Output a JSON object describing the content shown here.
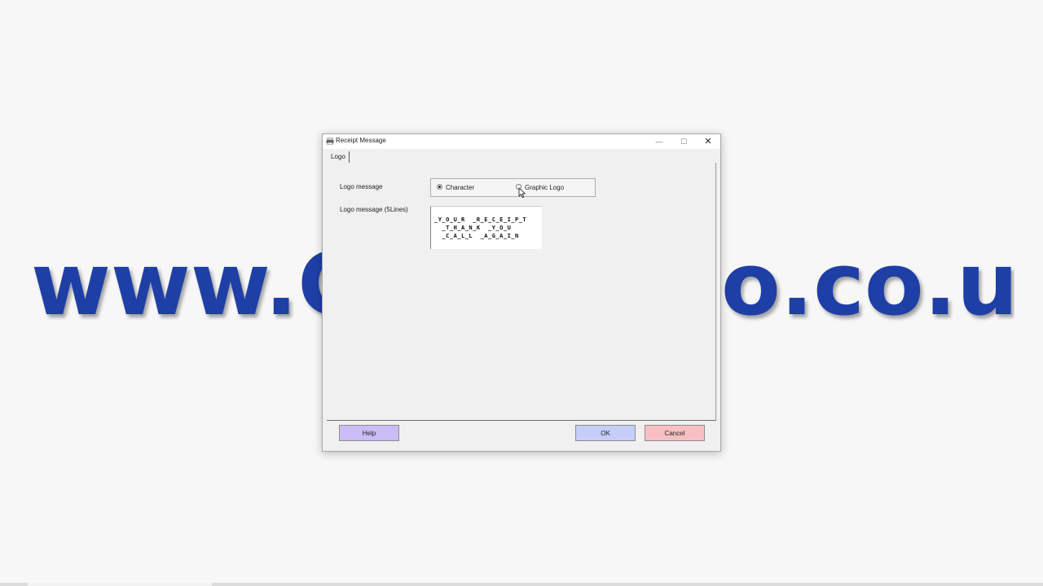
{
  "watermark": {
    "left_text": "www.C",
    "right_text": "o.co.uk"
  },
  "window": {
    "title": "Receipt Message",
    "controls": {
      "minimize": "—",
      "maximize": "☐",
      "close": "✕"
    }
  },
  "tabs": [
    {
      "label": "Logo",
      "selected": true
    }
  ],
  "form": {
    "logo_message_label": "Logo message",
    "logo_message_5lines_label": "Logo message (5Lines)",
    "radio_options": [
      {
        "label": "Character",
        "checked": true
      },
      {
        "label": "Graphic Logo",
        "checked": false
      }
    ],
    "logo_lines": [
      "_Y_O_U_R  _R_E_C_E_I_P_T",
      "  _T_H_A_N_K  _Y_O_U",
      "  _C_A_L_L  _A_G_A_I_N"
    ]
  },
  "buttons": {
    "help": "Help",
    "ok": "OK",
    "cancel": "Cancel"
  },
  "colors": {
    "watermark": "#1e3fa6",
    "help_button": "#cbbcf6",
    "ok_button": "#c4cef7",
    "cancel_button": "#f8c0c2"
  },
  "icons": {
    "app": "printer-icon",
    "cursor": "mouse-pointer-icon"
  }
}
